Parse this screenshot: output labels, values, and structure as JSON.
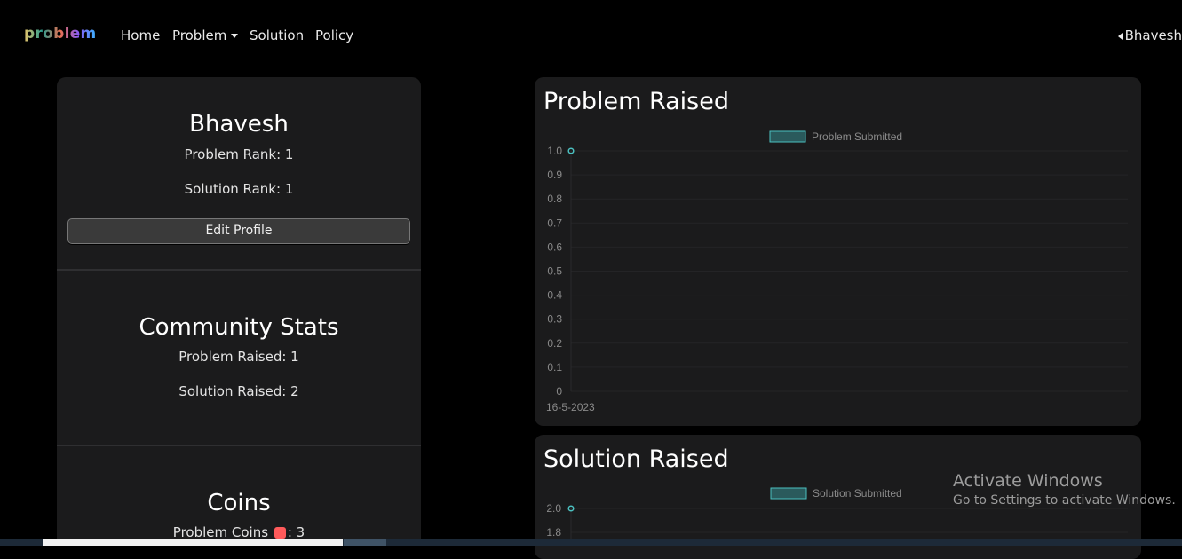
{
  "nav": {
    "brand": "problem",
    "links": [
      "Home",
      "Problem",
      "Solution",
      "Policy"
    ],
    "user": "Bhavesh"
  },
  "profile": {
    "name": "Bhavesh",
    "problem_rank": "Problem Rank: 1",
    "solution_rank": "Solution Rank: 1",
    "edit_button": "Edit Profile"
  },
  "community": {
    "title": "Community Stats",
    "problem_raised": "Problem Raised: 1",
    "solution_raised": "Solution Raised: 2"
  },
  "coins": {
    "title": "Coins",
    "problem_coins_label": "Problem Coins",
    "problem_coins_value": ": 3"
  },
  "colors": {
    "accent": "#4bc0c0",
    "card_bg": "#1b1b1c"
  },
  "chart_data": [
    {
      "type": "line",
      "title": "Problem Raised",
      "series": [
        {
          "name": "Problem Submitted",
          "values": [
            1
          ]
        }
      ],
      "categories": [
        "16-5-2023"
      ],
      "yticks": [
        "1.0",
        "0.9",
        "0.8",
        "0.7",
        "0.6",
        "0.5",
        "0.4",
        "0.3",
        "0.2",
        "0.1",
        "0"
      ],
      "ylim": [
        0,
        1
      ],
      "legend": "top-center",
      "grid": true
    },
    {
      "type": "line",
      "title": "Solution Raised",
      "series": [
        {
          "name": "Solution Submitted",
          "values": [
            2
          ]
        }
      ],
      "yticks": [
        "2.0",
        "1.8"
      ],
      "ylim": [
        0,
        2
      ],
      "legend": "top-center",
      "grid": true
    }
  ],
  "watermark": {
    "line1": "Activate Windows",
    "line2": "Go to Settings to activate Windows."
  }
}
